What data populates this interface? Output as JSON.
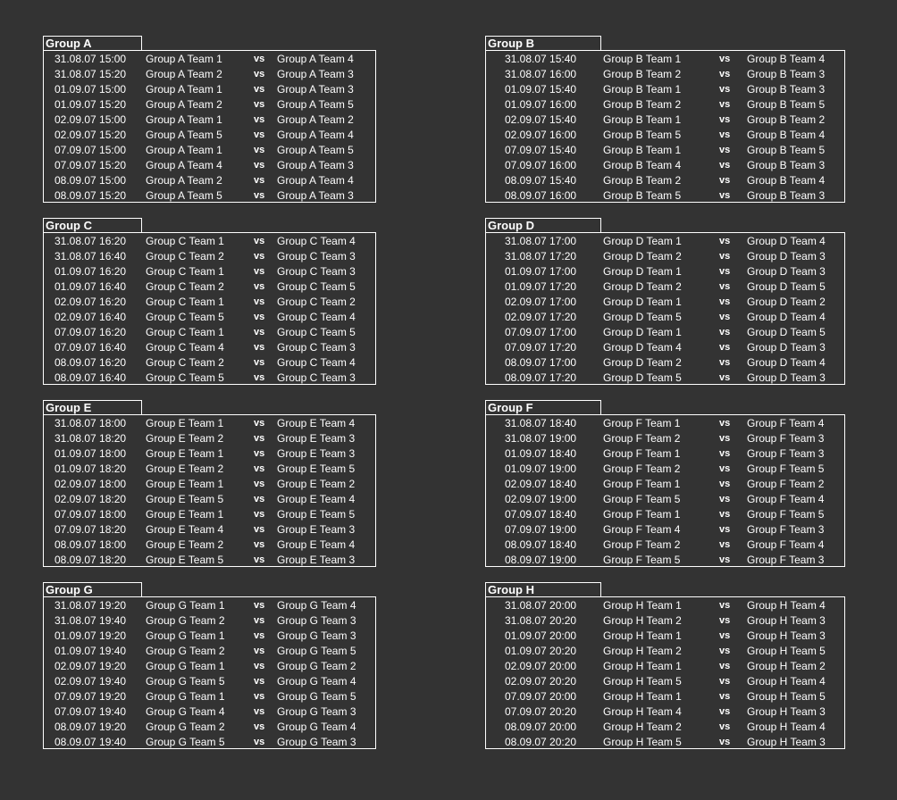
{
  "vs_label": "vs",
  "groups": [
    {
      "title": "Group A",
      "matches": [
        {
          "date": "31.08.07 15:00",
          "home": "Group A Team 1",
          "away": "Group A Team 4"
        },
        {
          "date": "31.08.07 15:20",
          "home": "Group A Team 2",
          "away": "Group A Team 3"
        },
        {
          "date": "01.09.07 15:00",
          "home": "Group A Team 1",
          "away": "Group A Team 3"
        },
        {
          "date": "01.09.07 15:20",
          "home": "Group A Team 2",
          "away": "Group A Team 5"
        },
        {
          "date": "02.09.07 15:00",
          "home": "Group A Team 1",
          "away": "Group A Team 2"
        },
        {
          "date": "02.09.07 15:20",
          "home": "Group A Team 5",
          "away": "Group A Team 4"
        },
        {
          "date": "07.09.07 15:00",
          "home": "Group A Team 1",
          "away": "Group A Team 5"
        },
        {
          "date": "07.09.07 15:20",
          "home": "Group A Team 4",
          "away": "Group A Team 3"
        },
        {
          "date": "08.09.07 15:00",
          "home": "Group A Team 2",
          "away": "Group A Team 4"
        },
        {
          "date": "08.09.07 15:20",
          "home": "Group A Team 5",
          "away": "Group A Team 3"
        }
      ]
    },
    {
      "title": "Group B",
      "matches": [
        {
          "date": "31.08.07 15:40",
          "home": "Group B Team 1",
          "away": "Group B Team 4"
        },
        {
          "date": "31.08.07 16:00",
          "home": "Group B Team 2",
          "away": "Group B Team 3"
        },
        {
          "date": "01.09.07 15:40",
          "home": "Group B Team 1",
          "away": "Group B Team 3"
        },
        {
          "date": "01.09.07 16:00",
          "home": "Group B Team 2",
          "away": "Group B Team 5"
        },
        {
          "date": "02.09.07 15:40",
          "home": "Group B Team 1",
          "away": "Group B Team 2"
        },
        {
          "date": "02.09.07 16:00",
          "home": "Group B Team 5",
          "away": "Group B Team 4"
        },
        {
          "date": "07.09.07 15:40",
          "home": "Group B Team 1",
          "away": "Group B Team 5"
        },
        {
          "date": "07.09.07 16:00",
          "home": "Group B Team 4",
          "away": "Group B Team 3"
        },
        {
          "date": "08.09.07 15:40",
          "home": "Group B Team 2",
          "away": "Group B Team 4"
        },
        {
          "date": "08.09.07 16:00",
          "home": "Group B Team 5",
          "away": "Group B Team 3"
        }
      ]
    },
    {
      "title": "Group C",
      "matches": [
        {
          "date": "31.08.07 16:20",
          "home": "Group C Team 1",
          "away": "Group C Team 4"
        },
        {
          "date": "31.08.07 16:40",
          "home": "Group C Team 2",
          "away": "Group C Team 3"
        },
        {
          "date": "01.09.07 16:20",
          "home": "Group C Team 1",
          "away": "Group C Team 3"
        },
        {
          "date": "01.09.07 16:40",
          "home": "Group C Team 2",
          "away": "Group C Team 5"
        },
        {
          "date": "02.09.07 16:20",
          "home": "Group C Team 1",
          "away": "Group C Team 2"
        },
        {
          "date": "02.09.07 16:40",
          "home": "Group C Team 5",
          "away": "Group C Team 4"
        },
        {
          "date": "07.09.07 16:20",
          "home": "Group C Team 1",
          "away": "Group C Team 5"
        },
        {
          "date": "07.09.07 16:40",
          "home": "Group C Team 4",
          "away": "Group C Team 3"
        },
        {
          "date": "08.09.07 16:20",
          "home": "Group C Team 2",
          "away": "Group C Team 4"
        },
        {
          "date": "08.09.07 16:40",
          "home": "Group C Team 5",
          "away": "Group C Team 3"
        }
      ]
    },
    {
      "title": "Group D",
      "matches": [
        {
          "date": "31.08.07 17:00",
          "home": "Group D Team 1",
          "away": "Group D Team 4"
        },
        {
          "date": "31.08.07 17:20",
          "home": "Group D Team 2",
          "away": "Group D Team 3"
        },
        {
          "date": "01.09.07 17:00",
          "home": "Group D Team 1",
          "away": "Group D Team 3"
        },
        {
          "date": "01.09.07 17:20",
          "home": "Group D Team 2",
          "away": "Group D Team 5"
        },
        {
          "date": "02.09.07 17:00",
          "home": "Group D Team 1",
          "away": "Group D Team 2"
        },
        {
          "date": "02.09.07 17:20",
          "home": "Group D Team 5",
          "away": "Group D Team 4"
        },
        {
          "date": "07.09.07 17:00",
          "home": "Group D Team 1",
          "away": "Group D Team 5"
        },
        {
          "date": "07.09.07 17:20",
          "home": "Group D Team 4",
          "away": "Group D Team 3"
        },
        {
          "date": "08.09.07 17:00",
          "home": "Group D Team 2",
          "away": "Group D Team 4"
        },
        {
          "date": "08.09.07 17:20",
          "home": "Group D Team 5",
          "away": "Group D Team 3"
        }
      ]
    },
    {
      "title": "Group E",
      "matches": [
        {
          "date": "31.08.07 18:00",
          "home": "Group E Team 1",
          "away": "Group E Team 4"
        },
        {
          "date": "31.08.07 18:20",
          "home": "Group E Team 2",
          "away": "Group E Team 3"
        },
        {
          "date": "01.09.07 18:00",
          "home": "Group E Team 1",
          "away": "Group E Team 3"
        },
        {
          "date": "01.09.07 18:20",
          "home": "Group E Team 2",
          "away": "Group E Team 5"
        },
        {
          "date": "02.09.07 18:00",
          "home": "Group E Team 1",
          "away": "Group E Team 2"
        },
        {
          "date": "02.09.07 18:20",
          "home": "Group E Team 5",
          "away": "Group E Team 4"
        },
        {
          "date": "07.09.07 18:00",
          "home": "Group E Team 1",
          "away": "Group E Team 5"
        },
        {
          "date": "07.09.07 18:20",
          "home": "Group E Team 4",
          "away": "Group E Team 3"
        },
        {
          "date": "08.09.07 18:00",
          "home": "Group E Team 2",
          "away": "Group E Team 4"
        },
        {
          "date": "08.09.07 18:20",
          "home": "Group E Team 5",
          "away": "Group E Team 3"
        }
      ]
    },
    {
      "title": "Group F",
      "matches": [
        {
          "date": "31.08.07 18:40",
          "home": "Group F Team 1",
          "away": "Group F Team 4"
        },
        {
          "date": "31.08.07 19:00",
          "home": "Group F Team 2",
          "away": "Group F Team 3"
        },
        {
          "date": "01.09.07 18:40",
          "home": "Group F Team 1",
          "away": "Group F Team 3"
        },
        {
          "date": "01.09.07 19:00",
          "home": "Group F Team 2",
          "away": "Group F Team 5"
        },
        {
          "date": "02.09.07 18:40",
          "home": "Group F Team 1",
          "away": "Group F Team 2"
        },
        {
          "date": "02.09.07 19:00",
          "home": "Group F Team 5",
          "away": "Group F Team 4"
        },
        {
          "date": "07.09.07 18:40",
          "home": "Group F Team 1",
          "away": "Group F Team 5"
        },
        {
          "date": "07.09.07 19:00",
          "home": "Group F Team 4",
          "away": "Group F Team 3"
        },
        {
          "date": "08.09.07 18:40",
          "home": "Group F Team 2",
          "away": "Group F Team 4"
        },
        {
          "date": "08.09.07 19:00",
          "home": "Group F Team 5",
          "away": "Group F Team 3"
        }
      ]
    },
    {
      "title": "Group G",
      "matches": [
        {
          "date": "31.08.07 19:20",
          "home": "Group G Team 1",
          "away": "Group G Team 4"
        },
        {
          "date": "31.08.07 19:40",
          "home": "Group G Team 2",
          "away": "Group G Team 3"
        },
        {
          "date": "01.09.07 19:20",
          "home": "Group G Team 1",
          "away": "Group G Team 3"
        },
        {
          "date": "01.09.07 19:40",
          "home": "Group G Team 2",
          "away": "Group G Team 5"
        },
        {
          "date": "02.09.07 19:20",
          "home": "Group G Team 1",
          "away": "Group G Team 2"
        },
        {
          "date": "02.09.07 19:40",
          "home": "Group G Team 5",
          "away": "Group G Team 4"
        },
        {
          "date": "07.09.07 19:20",
          "home": "Group G Team 1",
          "away": "Group G Team 5"
        },
        {
          "date": "07.09.07 19:40",
          "home": "Group G Team 4",
          "away": "Group G Team 3"
        },
        {
          "date": "08.09.07 19:20",
          "home": "Group G Team 2",
          "away": "Group G Team 4"
        },
        {
          "date": "08.09.07 19:40",
          "home": "Group G Team 5",
          "away": "Group G Team 3"
        }
      ]
    },
    {
      "title": "Group H",
      "matches": [
        {
          "date": "31.08.07 20:00",
          "home": "Group H Team 1",
          "away": "Group H Team 4"
        },
        {
          "date": "31.08.07 20:20",
          "home": "Group H Team 2",
          "away": "Group H Team 3"
        },
        {
          "date": "01.09.07 20:00",
          "home": "Group H Team 1",
          "away": "Group H Team 3"
        },
        {
          "date": "01.09.07 20:20",
          "home": "Group H Team 2",
          "away": "Group H Team 5"
        },
        {
          "date": "02.09.07 20:00",
          "home": "Group H Team 1",
          "away": "Group H Team 2"
        },
        {
          "date": "02.09.07 20:20",
          "home": "Group H Team 5",
          "away": "Group H Team 4"
        },
        {
          "date": "07.09.07 20:00",
          "home": "Group H Team 1",
          "away": "Group H Team 5"
        },
        {
          "date": "07.09.07 20:20",
          "home": "Group H Team 4",
          "away": "Group H Team 3"
        },
        {
          "date": "08.09.07 20:00",
          "home": "Group H Team 2",
          "away": "Group H Team 4"
        },
        {
          "date": "08.09.07 20:20",
          "home": "Group H Team 5",
          "away": "Group H Team 3"
        }
      ]
    }
  ]
}
